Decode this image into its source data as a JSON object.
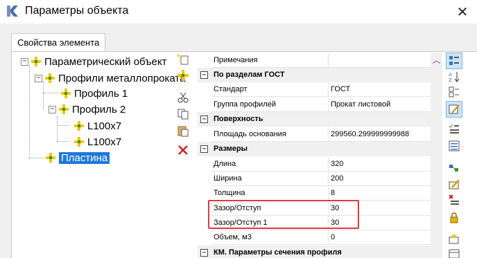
{
  "window": {
    "title": "Параметры объекта"
  },
  "tab": {
    "label": "Свойства элемента"
  },
  "tree": {
    "items": [
      {
        "label": "Параметрический объект"
      },
      {
        "label": "Профили металлопроката"
      },
      {
        "label": "Профиль 1"
      },
      {
        "label": "Профиль 2"
      },
      {
        "label": "L100x7"
      },
      {
        "label": "L100x7"
      },
      {
        "label": "Пластина"
      }
    ]
  },
  "grid": {
    "rows": [
      {
        "kind": "prop",
        "name": "Примечания",
        "value": ""
      },
      {
        "kind": "cat",
        "name": "По разделам ГОСТ"
      },
      {
        "kind": "prop",
        "name": "Стандарт",
        "value": "ГОСТ"
      },
      {
        "kind": "prop",
        "name": "Группа профилей",
        "value": "Прокат листовой"
      },
      {
        "kind": "cat",
        "name": "Поверхность"
      },
      {
        "kind": "prop",
        "name": "Площадь основания",
        "value": "299560.299999999988"
      },
      {
        "kind": "cat",
        "name": "Размеры"
      },
      {
        "kind": "prop",
        "name": "Длина",
        "value": "320"
      },
      {
        "kind": "prop",
        "name": "Ширина",
        "value": "200"
      },
      {
        "kind": "prop",
        "name": "Толщина",
        "value": "8"
      },
      {
        "kind": "prop",
        "name": "Зазор/Отступ",
        "value": "30"
      },
      {
        "kind": "prop",
        "name": "Зазор/Отступ 1",
        "value": "30"
      },
      {
        "kind": "prop",
        "name": "Объем, м3",
        "value": "0"
      },
      {
        "kind": "cat",
        "name": "КМ. Параметры сечения профиля"
      }
    ]
  },
  "icons": {
    "close": "close-icon",
    "delete_color": "#cc2222",
    "highlight_color": "#e0393e",
    "selection_color": "#1e78d7"
  }
}
